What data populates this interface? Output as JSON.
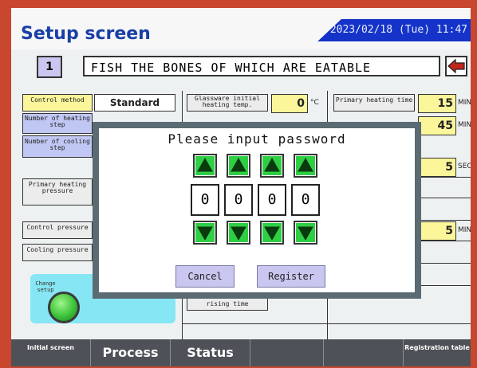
{
  "header": {
    "title": "Setup screen",
    "datetime": "2023/02/18 (Tue) 11:47"
  },
  "recipe": {
    "number": "1",
    "name": "FISH THE BONES OF WHICH ARE EATABLE"
  },
  "left_params": {
    "control_method": "Control method",
    "control_method_value": "Standard",
    "heating_steps": "Number of heating step",
    "cooling_steps": "Number of cooling step",
    "primary_heating_pressure": "Primary heating pressure",
    "control_pressure": "Control pressure",
    "cooling_pressure": "Cooling pressure",
    "change_setup": "Change setup"
  },
  "mid_params": {
    "glassware_temp": "Glassware initial heating temp.",
    "glassware_temp_value": "0",
    "glassware_temp_unit": "°C",
    "rising_time": "rising time"
  },
  "right_params": {
    "primary_heating_time": "Primary heating time",
    "v1": "15",
    "u1": "MIN",
    "v2": "45",
    "u2": "MIN",
    "v3": "5",
    "u3": "SEC",
    "v4": "5",
    "u4": "MIN"
  },
  "password_dialog": {
    "prompt": "Please input password",
    "digits": [
      "0",
      "0",
      "0",
      "0"
    ],
    "cancel_label": "Cancel",
    "register_label": "Register"
  },
  "footer": {
    "initial_screen": "Initial screen",
    "process": "Process",
    "status": "Status",
    "registration_table": "Registration table"
  },
  "colors": {
    "title_blue": "#1a3fa6",
    "date_bar": "#1533c9",
    "yellow_field": "#fbf69a",
    "button_lavender": "#c9c6ef",
    "arrow_green": "#2fcf45",
    "change_panel": "#86e6f3",
    "footer_bg": "#4e5157",
    "frame": "#c8472e"
  },
  "icons": [
    "back-arrow-icon",
    "up-arrow-icon",
    "down-arrow-icon",
    "change-setup-round-button"
  ]
}
